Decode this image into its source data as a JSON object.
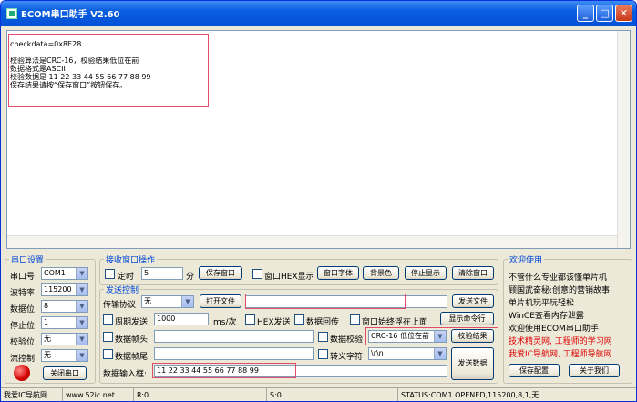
{
  "window": {
    "title": "ECOM串口助手   V2.60"
  },
  "receive": {
    "lines": [
      "checkdata=0x8E28",
      "",
      "校验算法是CRC-16，校验结果低位在前",
      "数据格式是ASCII",
      "校验数据是 11 22 33 44 55 66 77 88 99",
      "保存结果请按“保存窗口”按钮保存。"
    ]
  },
  "serial": {
    "legend": "串口设置",
    "port_label": "串口号",
    "port_value": "COM1",
    "baud_label": "波特率",
    "baud_value": "115200",
    "databits_label": "数据位",
    "databits_value": "8",
    "stopbits_label": "停止位",
    "stopbits_value": "1",
    "parity_label": "校验位",
    "parity_value": "无",
    "flow_label": "流控制",
    "flow_value": "无",
    "close_port_label": "关闭串口"
  },
  "recv_ops": {
    "legend": "接收窗口操作",
    "timer_label": "定时",
    "timer_value": "5",
    "timer_unit": "分",
    "save_window_label": "保存窗口",
    "hex_display_label": "窗口HEX显示",
    "font_label": "窗口字体",
    "bg_label": "背景色",
    "stop_display_label": "停止显示",
    "clear_display_label": "清除窗口"
  },
  "send": {
    "legend": "发送控制",
    "protocol_label": "传输协议",
    "protocol_value": "无",
    "open_file_label": "打开文件",
    "send_file_label": "发送文件",
    "period_label": "周期发送",
    "period_value": "1000",
    "period_unit": "ms/次",
    "hex_send_label": "HEX发送",
    "echo_label": "数据回传",
    "ontop_label": "窗口始终浮在上面",
    "show_cmd_label": "显示命令行",
    "header_label": "数据帧头",
    "checksum_label": "数据校验",
    "checksum_value": "CRC-16 低位在前",
    "checksum_result_label": "校验结果",
    "footer_label": "数据帧尾",
    "escape_label": "转义字符",
    "escape_value": "\\r\\n",
    "input_label": "数据输入框:",
    "input_value": "11 22 33 44 55 66 77 88 99",
    "send_data_label": "发送数据"
  },
  "welcome": {
    "legend": "欢迎使用",
    "lines": [
      "不管什么专业都该懂单片机",
      "顾国武奋秘:创意的营销故事",
      "单片机玩平玩轻松",
      "WinCE查看内存泄露",
      "欢迎使用ECOM串口助手"
    ],
    "red_lines": [
      "技术精灵网, 工程师的学习网",
      "我爱IC导航网, 工程师导航网"
    ],
    "save_config_label": "保存配置",
    "about_label": "关于我们"
  },
  "status": {
    "site": "我爱IC导航网",
    "url": "www.52ic.net",
    "r": "R:0",
    "s": "S:0",
    "port_status": "STATUS:COM1 OPENED,115200,8,1,无"
  },
  "colors": {
    "highlight": "#e24d6a",
    "title_bar": "#0a5ee0",
    "link_red": "#e00000"
  }
}
